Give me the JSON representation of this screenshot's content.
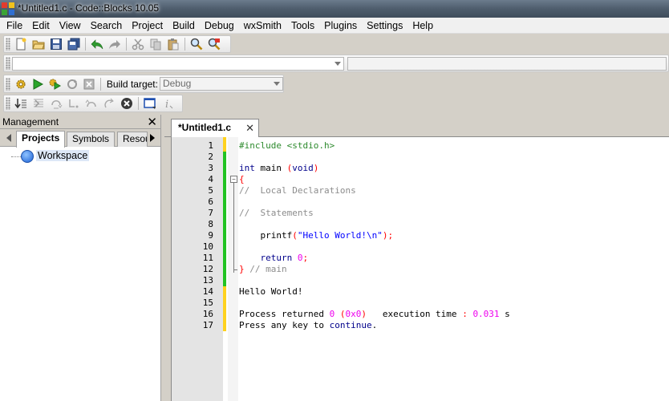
{
  "window": {
    "title": "*Untitled1.c - Code::Blocks 10.05"
  },
  "menubar": {
    "items": [
      "File",
      "Edit",
      "View",
      "Search",
      "Project",
      "Build",
      "Debug",
      "wxSmith",
      "Tools",
      "Plugins",
      "Settings",
      "Help"
    ]
  },
  "toolbar_main": {
    "icons": [
      "new-file-icon",
      "open-folder-icon",
      "save-icon",
      "save-all-icon",
      "undo-icon",
      "redo-icon",
      "cut-icon",
      "copy-icon",
      "paste-icon",
      "find-icon",
      "replace-icon"
    ]
  },
  "build_toolbar": {
    "icons": [
      "build-gear-icon",
      "run-icon",
      "build-and-run-icon",
      "rebuild-icon",
      "abort-icon"
    ],
    "target_label": "Build target:",
    "target_value": "Debug"
  },
  "debug_toolbar": {
    "icons": [
      "run-to-cursor-icon",
      "next-line-icon",
      "step-into-icon",
      "next-instruction-icon",
      "step-out-icon",
      "continue-icon",
      "stop-debugger-icon",
      "debug-windows-icon",
      "info-icon"
    ]
  },
  "management": {
    "title": "Management",
    "close": "✕",
    "tabs": [
      "Projects",
      "Symbols",
      "Resou"
    ],
    "active_tab": "Projects",
    "tree": {
      "root": "Workspace"
    }
  },
  "editor": {
    "tab_label": "*Untitled1.c",
    "tab_close": "✕",
    "line_numbers": [
      "1",
      "2",
      "3",
      "4",
      "5",
      "6",
      "7",
      "8",
      "9",
      "10",
      "11",
      "12",
      "13",
      "14",
      "15",
      "16",
      "17"
    ],
    "lines": [
      "#include <stdio.h>",
      "",
      "int main (void)",
      "{",
      "//  Local Declarations",
      "",
      "//  Statements",
      "",
      "    printf(\"Hello World!\\n\");",
      "",
      "    return 0;",
      "} // main",
      "",
      "Hello World!",
      "",
      "Process returned 0 (0x0)   execution time : 0.031 s",
      "Press any key to continue."
    ]
  },
  "colors": {
    "change_saved": "#22c322",
    "change_unsaved": "#ffd21e",
    "preprocessor": "#2d8a2d",
    "keyword": "#00008b",
    "string": "#0000ff",
    "number": "#ee00ee",
    "comment": "#8c8c8c",
    "operator": "#ff0000"
  }
}
